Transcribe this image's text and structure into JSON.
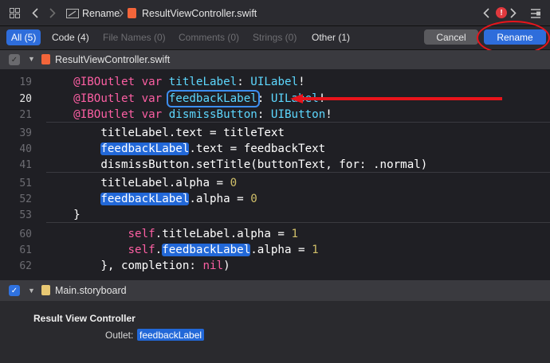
{
  "toolbar": {
    "breadcrumb_action": "Rename",
    "breadcrumb_file": "ResultViewController.swift",
    "issue_count": "!"
  },
  "filters": {
    "all": "All (5)",
    "code": "Code (4)",
    "file_names": "File Names (0)",
    "comments": "Comments (0)",
    "strings": "Strings (0)",
    "other": "Other (1)"
  },
  "actions": {
    "cancel": "Cancel",
    "rename": "Rename"
  },
  "file_section": {
    "name": "ResultViewController.swift",
    "checked": false
  },
  "code": {
    "lines": [
      {
        "num": "19",
        "indent": "    ",
        "parts": [
          [
            "kw",
            "@IBOutlet"
          ],
          [
            "pl",
            " "
          ],
          [
            "kw",
            "var"
          ],
          [
            "pl",
            " "
          ],
          [
            "ty",
            "titleLabel"
          ],
          [
            "pl",
            ": "
          ],
          [
            "ty",
            "UILabel"
          ],
          [
            "pl",
            "!"
          ]
        ]
      },
      {
        "num": "20",
        "indent": "    ",
        "parts": [
          [
            "kw",
            "@IBOutlet"
          ],
          [
            "pl",
            " "
          ],
          [
            "kw",
            "var"
          ],
          [
            "pl",
            " "
          ],
          [
            "hl",
            "feedbackLabel"
          ],
          [
            "pl",
            ": "
          ],
          [
            "ty",
            "UILabel"
          ],
          [
            "pl",
            "!"
          ]
        ],
        "current": true
      },
      {
        "num": "21",
        "indent": "    ",
        "parts": [
          [
            "kw",
            "@IBOutlet"
          ],
          [
            "pl",
            " "
          ],
          [
            "kw",
            "var"
          ],
          [
            "pl",
            " "
          ],
          [
            "ty",
            "dismissButton"
          ],
          [
            "pl",
            ": "
          ],
          [
            "ty",
            "UIButton"
          ],
          [
            "pl",
            "!"
          ]
        ]
      },
      {
        "num": "39",
        "indent": "        ",
        "parts": [
          [
            "pl",
            "titleLabel.text = titleText"
          ]
        ]
      },
      {
        "num": "40",
        "indent": "        ",
        "parts": [
          [
            "hl",
            "feedbackLabel"
          ],
          [
            "pl",
            ".text = feedbackText"
          ]
        ]
      },
      {
        "num": "41",
        "indent": "        ",
        "parts": [
          [
            "pl",
            "dismissButton.setTitle(buttonText, for: .normal)"
          ]
        ]
      },
      {
        "num": "51",
        "indent": "        ",
        "parts": [
          [
            "pl",
            "titleLabel.alpha = "
          ],
          [
            "num",
            "0"
          ]
        ]
      },
      {
        "num": "52",
        "indent": "        ",
        "parts": [
          [
            "hl",
            "feedbackLabel"
          ],
          [
            "pl",
            ".alpha = "
          ],
          [
            "num",
            "0"
          ]
        ]
      },
      {
        "num": "53",
        "indent": "    ",
        "parts": [
          [
            "pl",
            "}"
          ]
        ]
      },
      {
        "num": "60",
        "indent": "            ",
        "parts": [
          [
            "kw",
            "self"
          ],
          [
            "pl",
            ".titleLabel.alpha = "
          ],
          [
            "num",
            "1"
          ]
        ]
      },
      {
        "num": "61",
        "indent": "            ",
        "parts": [
          [
            "kw",
            "self"
          ],
          [
            "pl",
            "."
          ],
          [
            "hl",
            "feedbackLabel"
          ],
          [
            "pl",
            ".alpha = "
          ],
          [
            "num",
            "1"
          ]
        ]
      },
      {
        "num": "62",
        "indent": "        ",
        "parts": [
          [
            "pl",
            "}, completion: "
          ],
          [
            "kw",
            "nil"
          ],
          [
            "pl",
            ")"
          ]
        ]
      }
    ]
  },
  "storyboard_section": {
    "name": "Main.storyboard",
    "checked": true,
    "controller_title": "Result View Controller",
    "outlet_label": "Outlet:",
    "outlet_value": "feedbackLabel"
  },
  "colors": {
    "accent": "#2e6ddb",
    "annotation": "#e8141b",
    "keyword": "#fc5fa3",
    "type": "#5dd8ff",
    "number": "#d0bf69"
  }
}
